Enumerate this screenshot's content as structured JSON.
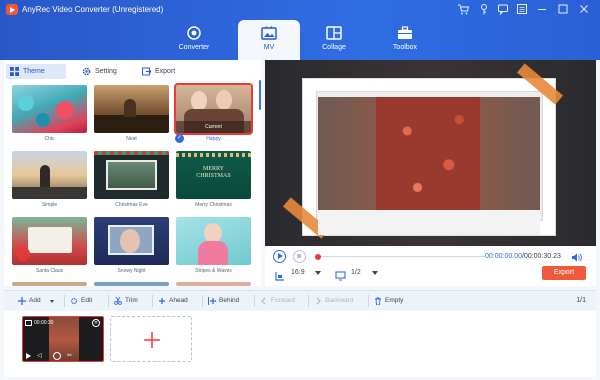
{
  "app": {
    "title": "AnyRec Video Converter (Unregistered)"
  },
  "titlebar_icons": [
    "cart-icon",
    "key-icon",
    "chat-icon",
    "menu-icon",
    "minimize-icon",
    "maximize-icon",
    "close-icon"
  ],
  "nav": {
    "converter": "Converter",
    "mv": "MV",
    "collage": "Collage",
    "toolbox": "Toolbox"
  },
  "subtabs": {
    "theme": "Theme",
    "setting": "Setting",
    "export": "Export"
  },
  "themes": [
    "Chic",
    "Neat",
    "Happy",
    "Simple",
    "Christmas Eve",
    "Merry Christmas",
    "Santa Claus",
    "Snowy Night",
    "Stripes & Waves"
  ],
  "theme_card_text": {
    "merry": "MERRY\nCHRISTMAS",
    "happy_current": "Current"
  },
  "selected_theme": "Happy",
  "player": {
    "time_current": "00:00:00.00",
    "time_total": "00:00:30.23",
    "time_sep": "/",
    "aspect": "16:9",
    "page": "1/2",
    "export_label": "Export",
    "progress": 0.0
  },
  "toolbar": {
    "add": "Add",
    "edit": "Edit",
    "trim": "Trim",
    "ahead": "Ahead",
    "behind": "Behind",
    "forward": "Forward",
    "backward": "Backward",
    "empty": "Empty",
    "page": "1/1"
  },
  "clip": {
    "duration": "00:00:30"
  },
  "colors": {
    "accent": "#2f6de3",
    "brand_header": "#2a5ad0",
    "export": "#f05a3a",
    "selection": "#e83a3a"
  }
}
